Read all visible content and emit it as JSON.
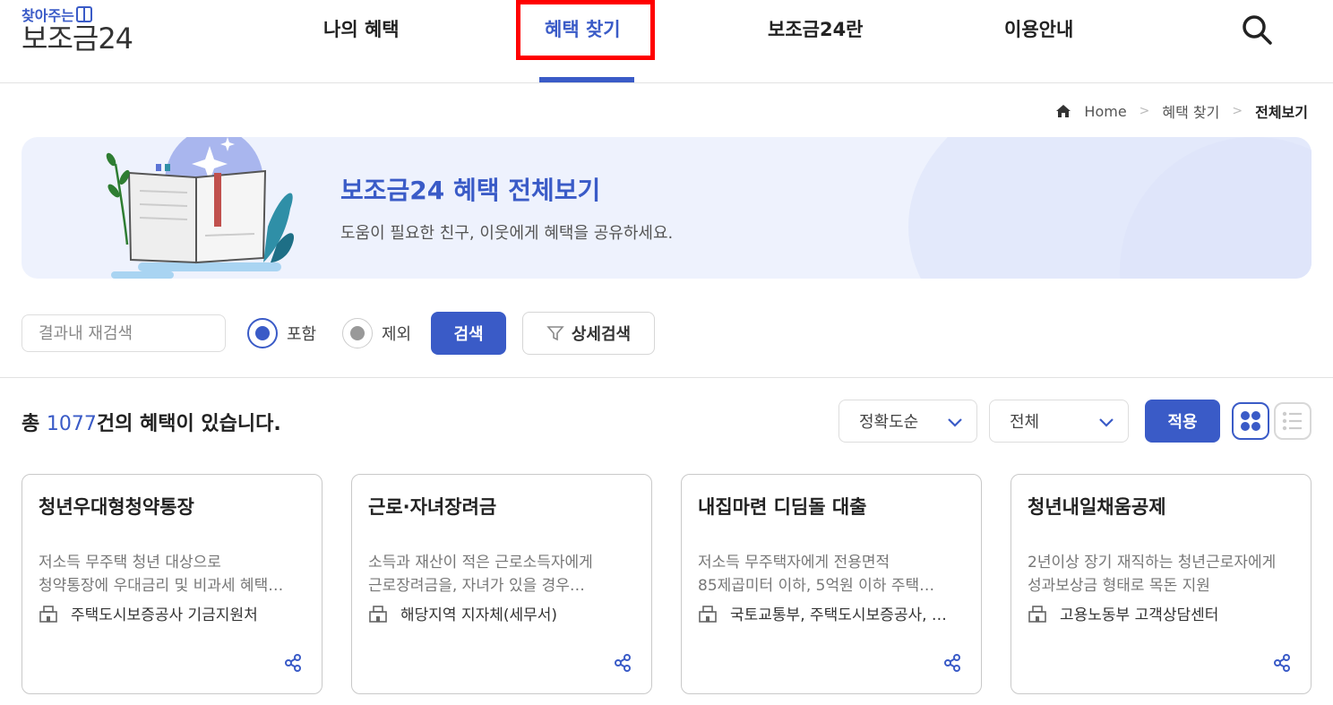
{
  "header": {
    "logo_sub": "찾아주는",
    "logo_main": "보조금24",
    "nav": [
      {
        "label": "나의 혜택"
      },
      {
        "label": "혜택 찾기"
      },
      {
        "label": "보조금24란"
      },
      {
        "label": "이용안내"
      }
    ],
    "search_icon": "search-icon"
  },
  "breadcrumb": {
    "home": "Home",
    "level1": "혜택 찾기",
    "current": "전체보기"
  },
  "banner": {
    "title": "보조금24 혜택 전체보기",
    "subtitle": "도움이 필요한 친구, 이웃에게 혜택을 공유하세요."
  },
  "search": {
    "placeholder": "결과내 재검색",
    "value": "",
    "radio_include": "포함",
    "radio_exclude": "제외",
    "selected": "포함",
    "search_button": "검색",
    "detail_button": "상세검색"
  },
  "results": {
    "prefix": "총 ",
    "count": "1077",
    "suffix": "건의 혜택이 있습니다.",
    "sort_value": "정확도순",
    "filter_value": "전체",
    "apply_button": "적용",
    "view_mode": "grid"
  },
  "cards": [
    {
      "title": "청년우대형청약통장",
      "desc1": "저소득 무주택 청년 대상으로",
      "desc2": "청약통장에 우대금리 및 비과세 혜택…",
      "org": "주택도시보증공사 기금지원처"
    },
    {
      "title": "근로·자녀장려금",
      "desc1": "소득과 재산이 적은 근로소득자에게",
      "desc2": "근로장려금을, 자녀가 있을 경우…",
      "org": "해당지역 지자체(세무서)"
    },
    {
      "title": "내집마련 디딤돌 대출",
      "desc1": "저소득 무주택자에게 전용면적",
      "desc2": "85제곱미터 이하, 5억원 이하 주택…",
      "org": "국토교통부, 주택도시보증공사, …"
    },
    {
      "title": "청년내일채움공제",
      "desc1": "2년이상 장기 재직하는 청년근로자에게",
      "desc2": "성과보상금 형태로 목돈 지원",
      "org": "고용노동부 고객상담센터"
    }
  ],
  "colors": {
    "brand": "#3a5bc7",
    "highlight": "#ff0000"
  }
}
